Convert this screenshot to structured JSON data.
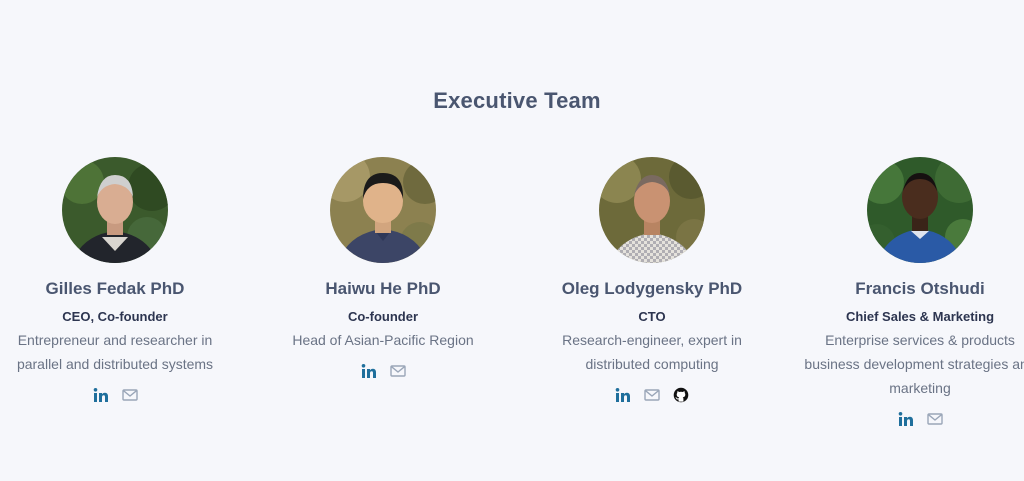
{
  "section": {
    "title": "Executive Team"
  },
  "members": [
    {
      "name": "Gilles Fedak PhD",
      "role": "CEO, Co-founder",
      "description": "Entrepreneur and researcher in parallel and distributed systems",
      "socials": [
        "linkedin-icon",
        "email-icon"
      ]
    },
    {
      "name": "Haiwu He PhD",
      "role": "Co-founder",
      "description": "Head of Asian-Pacific Region",
      "socials": [
        "linkedin-icon",
        "email-icon"
      ]
    },
    {
      "name": "Oleg Lodygensky PhD",
      "role": "CTO",
      "description": "Research-engineer, expert in distributed computing",
      "socials": [
        "linkedin-icon",
        "email-icon",
        "github-icon"
      ]
    },
    {
      "name": "Francis Otshudi",
      "role": "Chief Sales & Marketing",
      "description": "Enterprise services & products business development strategies and marketing",
      "socials": [
        "linkedin-icon",
        "email-icon"
      ]
    }
  ],
  "colors": {
    "background": "#f6f7fb",
    "heading": "#4a5670",
    "role": "#2d3550",
    "description": "#6a7385",
    "linkedin": "#1f6f9c",
    "email": "#9aa6b8",
    "github": "#111111"
  }
}
